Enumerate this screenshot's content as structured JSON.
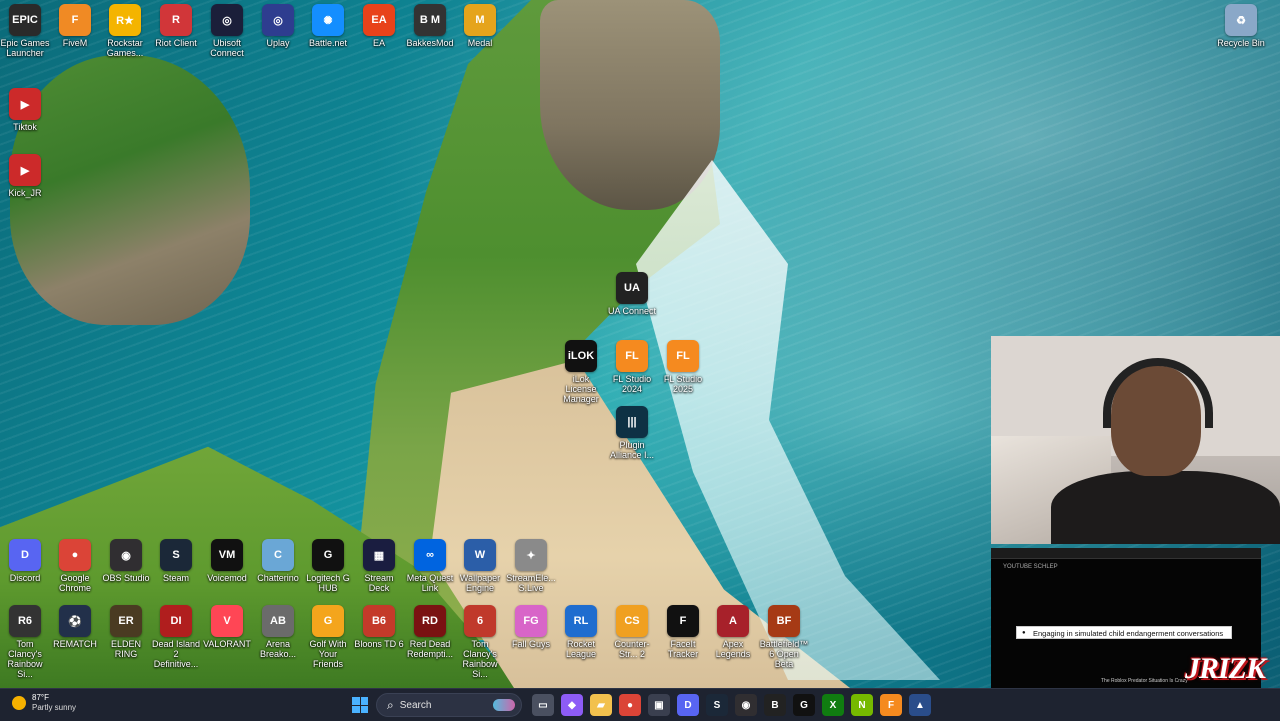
{
  "desktop_icons": [
    {
      "label": "Epic Games Launcher",
      "glyph": "EPIC",
      "color": "#2a2a2a"
    },
    {
      "label": "FiveM",
      "glyph": "F",
      "color": "#f08a24"
    },
    {
      "label": "Rockstar Games...",
      "glyph": "R★",
      "color": "#f4b400"
    },
    {
      "label": "Riot Client",
      "glyph": "R",
      "color": "#d13639"
    },
    {
      "label": "Ubisoft Connect",
      "glyph": "◎",
      "color": "#1b1f3a"
    },
    {
      "label": "Uplay",
      "glyph": "◎",
      "color": "#2e3d8f"
    },
    {
      "label": "Battle.net",
      "glyph": "✺",
      "color": "#148eff"
    },
    {
      "label": "EA",
      "glyph": "EA",
      "color": "#e8421a"
    },
    {
      "label": "BakkesMod",
      "glyph": "B M",
      "color": "#333"
    },
    {
      "label": "Medal",
      "glyph": "M",
      "color": "#e5a41c"
    },
    {
      "label": "Tiktok",
      "glyph": "▶",
      "color": "#cc2a2a"
    },
    {
      "label": "Kick_JR",
      "glyph": "▶",
      "color": "#cc2a2a"
    },
    {
      "label": "Recycle Bin",
      "glyph": "♻",
      "color": "#8aa8c8"
    },
    {
      "label": "UA Connect",
      "glyph": "UA",
      "color": "#222"
    },
    {
      "label": "iLok License Manager",
      "glyph": "iLOK",
      "color": "#111"
    },
    {
      "label": "FL Studio 2024",
      "glyph": "FL",
      "color": "#f58a1f"
    },
    {
      "label": "FL Studio 2025",
      "glyph": "FL",
      "color": "#f58a1f"
    },
    {
      "label": "Plugin Alliance I...",
      "glyph": "|||",
      "color": "#0e3144"
    },
    {
      "label": "Discord",
      "glyph": "D",
      "color": "#5865f2"
    },
    {
      "label": "Google Chrome",
      "glyph": "●",
      "color": "#db4437"
    },
    {
      "label": "OBS Studio",
      "glyph": "◉",
      "color": "#302e31"
    },
    {
      "label": "Steam",
      "glyph": "S",
      "color": "#1b2838"
    },
    {
      "label": "Voicemod",
      "glyph": "VM",
      "color": "#111"
    },
    {
      "label": "Chatterino",
      "glyph": "C",
      "color": "#6aa7d6"
    },
    {
      "label": "Logitech G HUB",
      "glyph": "G",
      "color": "#111"
    },
    {
      "label": "Stream Deck",
      "glyph": "▦",
      "color": "#1a1d40"
    },
    {
      "label": "Meta Quest Link",
      "glyph": "∞",
      "color": "#0064e0"
    },
    {
      "label": "Wallpaper Engine",
      "glyph": "W",
      "color": "#2b5ea8"
    },
    {
      "label": "StreamEle... S.Live",
      "glyph": "✦",
      "color": "#8a8a8a"
    },
    {
      "label": "Tom Clancy's Rainbow Si...",
      "glyph": "R6",
      "color": "#333"
    },
    {
      "label": "REMATCH",
      "glyph": "⚽",
      "color": "#22304a"
    },
    {
      "label": "ELDEN RING",
      "glyph": "ER",
      "color": "#4a3b22"
    },
    {
      "label": "Dead Island 2 Definitive...",
      "glyph": "DI",
      "color": "#b01e1e"
    },
    {
      "label": "VALORANT",
      "glyph": "V",
      "color": "#ff4655"
    },
    {
      "label": "Arena Breako...",
      "glyph": "AB",
      "color": "#6b6b6b"
    },
    {
      "label": "Golf With Your Friends",
      "glyph": "G",
      "color": "#f4a51c"
    },
    {
      "label": "Bloons TD 6",
      "glyph": "B6",
      "color": "#c43a2a"
    },
    {
      "label": "Red Dead Redempti...",
      "glyph": "RD",
      "color": "#7a1212"
    },
    {
      "label": "Tom Clancy's Rainbow Si...",
      "glyph": "6",
      "color": "#c0392b"
    },
    {
      "label": "Fall Guys",
      "glyph": "FG",
      "color": "#d865c8"
    },
    {
      "label": "Rocket League",
      "glyph": "RL",
      "color": "#1f6dcf"
    },
    {
      "label": "Counter-Str... 2",
      "glyph": "CS",
      "color": "#f0a020"
    },
    {
      "label": "FaceIt Tracker",
      "glyph": "F",
      "color": "#111"
    },
    {
      "label": "Apex Legends",
      "glyph": "A",
      "color": "#a7212a"
    },
    {
      "label": "Battlefield™ 6 Open Beta",
      "glyph": "BF",
      "color": "#a63a15"
    }
  ],
  "stream_panel": {
    "header": "YOUTUBE  SCHLEP",
    "popup": "Engaging in simulated child endangerment conversations",
    "caption": "The Roblox Predator Situation Is Crazy",
    "logo": "JRIZK"
  },
  "taskbar": {
    "weather_temp": "87°F",
    "weather_cond": "Partly sunny",
    "search_label": "Search",
    "apps": [
      {
        "name": "file-icon",
        "glyph": "▭",
        "color": "#4a5060"
      },
      {
        "name": "copilot-icon",
        "glyph": "◆",
        "color": "#8d5cf6"
      },
      {
        "name": "folder-icon",
        "glyph": "▰",
        "color": "#f2c14e"
      },
      {
        "name": "chrome-icon",
        "glyph": "●",
        "color": "#db4437"
      },
      {
        "name": "store-icon",
        "glyph": "▣",
        "color": "#3a3f4f"
      },
      {
        "name": "discord-icon",
        "glyph": "D",
        "color": "#5865f2"
      },
      {
        "name": "steam-icon",
        "glyph": "S",
        "color": "#1b2838"
      },
      {
        "name": "obs-icon",
        "glyph": "◉",
        "color": "#302e31"
      },
      {
        "name": "bakkesmod-icon",
        "glyph": "B",
        "color": "#222"
      },
      {
        "name": "logitech-icon",
        "glyph": "G",
        "color": "#111"
      },
      {
        "name": "xbox-icon",
        "glyph": "X",
        "color": "#107c10"
      },
      {
        "name": "nvidia-icon",
        "glyph": "N",
        "color": "#76b900"
      },
      {
        "name": "fl-studio-icon",
        "glyph": "F",
        "color": "#f58a1f"
      },
      {
        "name": "vpn-icon",
        "glyph": "▲",
        "color": "#2a4d8a"
      }
    ]
  }
}
